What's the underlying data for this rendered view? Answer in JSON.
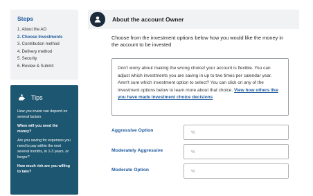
{
  "steps": {
    "title": "Steps",
    "items": [
      {
        "label": "1. About the AO",
        "active": false
      },
      {
        "label": "2. Choose Investments",
        "active": true
      },
      {
        "label": "3. Contribution method",
        "active": false
      },
      {
        "label": "4. Delivery method",
        "active": false
      },
      {
        "label": "5. Security",
        "active": false
      },
      {
        "label": "6. Review & Submit",
        "active": false
      }
    ]
  },
  "tips": {
    "title": "Tips",
    "icon": "piggy-bank-icon",
    "paragraphs": [
      "How you invest can depend on several factors",
      "When will you need the money?",
      "Are you saving for expenses you need to pay within the next several months, in 1-3 years, or longer?",
      "How much risk are you willing to take?"
    ]
  },
  "header": {
    "title": "About the account Owner",
    "icon": "user-icon"
  },
  "intro": "Choose from the investment options below how you would like the money in the account to be invested",
  "info": {
    "text": "Don't worry about making the wrong choice! your account is flexible. You can adjust which investments you are saving in up to two times per calendar year. Aren't sure which investment option to select? You can click on any of the investment options below to learn more about that choice. ",
    "link": "View how others like you have made investment choice decisions"
  },
  "options": [
    {
      "label": "Aggressive Option",
      "placeholder": "%"
    },
    {
      "label": "Moderately Aggressive",
      "placeholder": "%"
    },
    {
      "label": "Moderate Option",
      "placeholder": "%"
    }
  ],
  "colors": {
    "accent": "#1f5a9c",
    "tips_bg": "#1d5670",
    "panel_bg": "#f1f2f4",
    "avatar_bg": "#1c2b3a"
  }
}
